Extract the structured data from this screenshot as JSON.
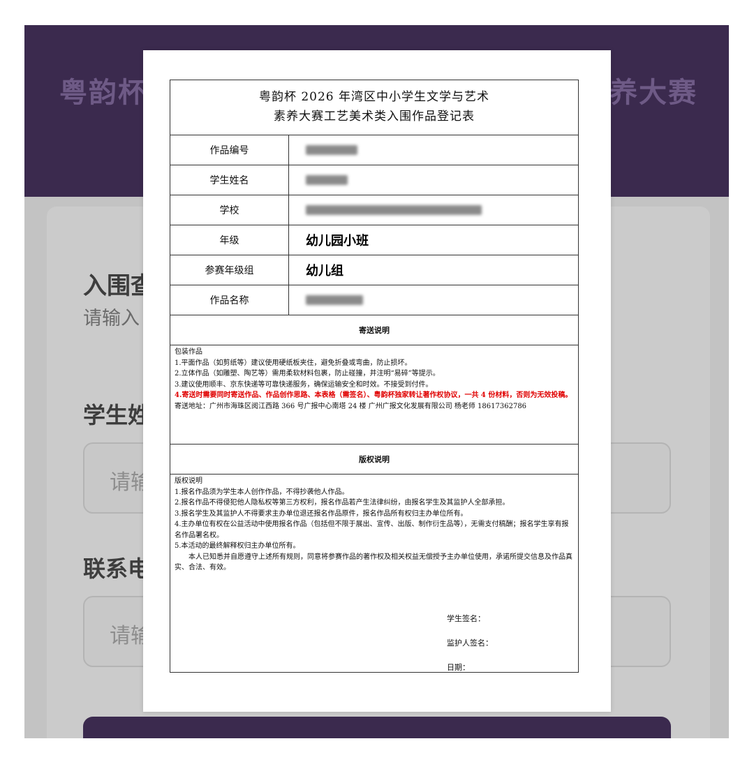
{
  "background": {
    "title_left": "粤韵杯",
    "title_right": "养大赛",
    "section_heading": "入围查",
    "section_hint": "请输入",
    "field1_label": "学生姓",
    "field1_placeholder": "请输",
    "field2_label": "联系电",
    "field2_placeholder": "请输"
  },
  "document": {
    "title_line1": "粤韵杯 2026 年湾区中小学生文学与艺术",
    "title_line2": "素养大赛工艺美术类入围作品登记表",
    "rows": [
      {
        "label": "作品编号",
        "value": "",
        "blurred": true
      },
      {
        "label": "学生姓名",
        "value": "",
        "blurred": true
      },
      {
        "label": "学校",
        "value": "",
        "blurred": true
      },
      {
        "label": "年级",
        "value": "幼儿园小班",
        "blurred": false
      },
      {
        "label": "参赛年级组",
        "value": "幼儿组",
        "blurred": false
      },
      {
        "label": "作品名称",
        "value": "",
        "blurred": true
      }
    ],
    "shipping": {
      "heading": "寄送说明",
      "lines": [
        "包装作品",
        "1.平面作品（如剪纸等）建议使用硬纸板夹住，避免折叠或弯曲，防止损坏。",
        "2.立体作品（如雕塑、陶艺等）需用柔软材料包裹，防止碰撞，并注明“易碎”等提示。",
        "3.建议使用顺丰、京东快递等可靠快递服务，确保运输安全和时效。不接受到付件。"
      ],
      "red_line": "4.寄送时需要同时寄送作品、作品创作思路、本表格（需签名）、粤韵杯独家转让著作权协议，一共 4 份材料，否则为无效投稿。",
      "address": "寄送地址：广州市海珠区阅江西路 366 号广报中心南塔 24 楼  广州广报文化发展有限公司  杨老师 18617362786"
    },
    "copyright": {
      "heading": "版权说明",
      "lines": [
        "版权说明",
        "1.报名作品须为学生本人创作作品，不得抄袭他人作品。",
        "2.报名作品不得侵犯他人隐私权等第三方权利，报名作品若产生法律纠纷，由报名学生及其监护人全部承担。",
        "3.报名学生及其监护人不得要求主办单位退还报名作品原件，报名作品所有权归主办单位所有。",
        "4.主办单位有权在公益活动中使用报名作品（包括但不限于展出、宣传、出版、制作衍生品等），无需支付稿酬；报名学生享有报名作品署名权。",
        "5.本活动的最终解释权归主办单位所有。"
      ],
      "declaration": "本人已知悉并自愿遵守上述所有规则，同意将参赛作品的著作权及相关权益无偿授予主办单位使用，承诺所提交信息及作品真实、合法、有效。"
    },
    "signatures": {
      "student": "学生签名：",
      "guardian": "监护人签名：",
      "date": "日期："
    }
  }
}
